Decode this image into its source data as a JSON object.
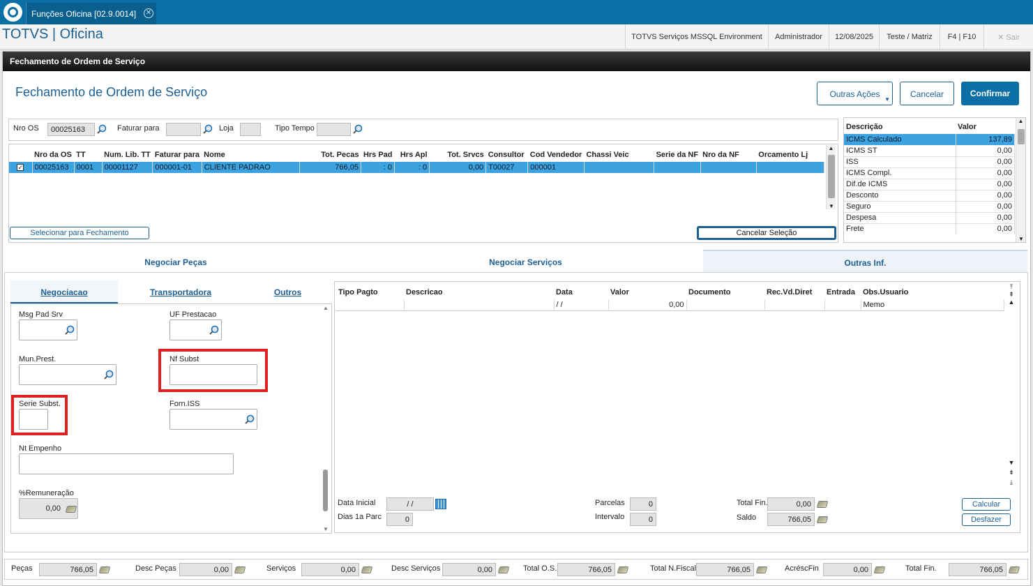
{
  "window": {
    "tab_title": "Funções Oficina [02.9.0014]",
    "brand": "TOTVS | Oficina"
  },
  "header": {
    "environment": "TOTVS Serviços MSSQL Environment",
    "user": "Administrador",
    "date": "12/08/2025",
    "branch": "Teste / Matriz",
    "shortcut": "F4 | F10",
    "exit": "Sair"
  },
  "dialog": {
    "bar_title": "Fechamento de Ordem de Serviço",
    "title": "Fechamento de Ordem de Serviço",
    "buttons": {
      "other_actions": "Outras Ações",
      "cancel": "Cancelar",
      "confirm": "Confirmar"
    }
  },
  "filters": {
    "nro_os_label": "Nro OS",
    "nro_os_value": "00025163",
    "faturar_label": "Faturar para",
    "loja_label": "Loja",
    "tipo_tempo_label": "Tipo Tempo"
  },
  "os_grid": {
    "columns": [
      "Nro da OS",
      "TT",
      "Num. Lib. TT",
      "Faturar para",
      "Nome",
      "Tot. Pecas",
      "Hrs Pad",
      "Hrs Apl",
      "Tot. Srvcs",
      "Consultor",
      "Cod Vendedor",
      "Chassi Veic",
      "Serie da NF",
      "Nro da NF",
      "Orcamento Lj"
    ],
    "rows": [
      [
        "00025163",
        "0001",
        "00001127",
        "000001-01",
        "CLIENTE PADRAO",
        "766,05",
        ": 0",
        ": 0",
        "0,00",
        "T00027",
        "000001",
        "",
        "",
        "",
        ""
      ]
    ],
    "select_button": "Selecionar para Fechamento",
    "cancel_selection_button": "Cancelar Seleção"
  },
  "tax_grid": {
    "columns": [
      "Descrição",
      "Valor"
    ],
    "rows": [
      [
        "ICMS Calculado",
        "137,89"
      ],
      [
        "ICMS ST",
        "0,00"
      ],
      [
        "ISS",
        "0,00"
      ],
      [
        "ICMS Compl.",
        "0,00"
      ],
      [
        "Dif.de ICMS",
        "0,00"
      ],
      [
        "Desconto",
        "0,00"
      ],
      [
        "Seguro",
        "0,00"
      ],
      [
        "Despesa",
        "0,00"
      ],
      [
        "Frete",
        "0,00"
      ]
    ]
  },
  "main_tabs": [
    "Negociar Peças",
    "Negociar Serviços",
    "Outras Inf."
  ],
  "sub_tabs": [
    "Negociacao",
    "Transportadora",
    "Outros"
  ],
  "form": {
    "msg_pad_srv": "Msg Pad Srv",
    "uf_prestacao": "UF Prestacao",
    "mun_prest": "Mun.Prest.",
    "nf_subst": "Nf Subst",
    "serie_subst": "Serie Subst.",
    "forn_iss": "Forn.ISS",
    "nt_empenho": "Nt Empenho",
    "remuneracao": "%Remuneração",
    "remuneracao_value": "0,00"
  },
  "payment_grid": {
    "columns": [
      "Tipo Pagto",
      "Descricao",
      "Data",
      "Valor",
      "Documento",
      "Rec.Vd.Diret",
      "Entrada",
      "Obs.Usuario"
    ],
    "rows": [
      [
        "",
        "",
        "/ /",
        "0,00",
        "",
        "",
        "",
        "Memo"
      ]
    ]
  },
  "payment_footer": {
    "data_inicial_label": "Data Inicial",
    "data_inicial_value": "/ /",
    "dias_label": "Dias 1a Parc",
    "dias_value": "0",
    "parcelas_label": "Parcelas",
    "parcelas_value": "0",
    "intervalo_label": "Intervalo",
    "intervalo_value": "0",
    "total_fin_label": "Total Fin.",
    "total_fin_value": "0,00",
    "saldo_label": "Saldo",
    "saldo_value": "766,05",
    "calc_button": "Calcular",
    "undo_button": "Desfazer"
  },
  "totals": [
    {
      "label": "Peças",
      "value": "766,05"
    },
    {
      "label": "Desc Peças",
      "value": "0,00"
    },
    {
      "label": "Serviços",
      "value": "0,00"
    },
    {
      "label": "Desc Serviços",
      "value": "0,00"
    },
    {
      "label": "Total O.S.",
      "value": "766,05"
    },
    {
      "label": "Total N.Fiscal",
      "value": "766,05"
    },
    {
      "label": "AcrésсFin",
      "value": "0,00"
    },
    {
      "label": "Total Fin.",
      "value": "766,05"
    }
  ],
  "colors": {
    "brand": "#0b6fa6",
    "selection": "#3da3e0",
    "highlight": "#e02020"
  },
  "icons": [
    "totvs-logo-icon",
    "close-tab-icon",
    "search-icon",
    "checkbox-icon",
    "money-icon",
    "calendar-icon",
    "scroll-arrow-icon"
  ]
}
